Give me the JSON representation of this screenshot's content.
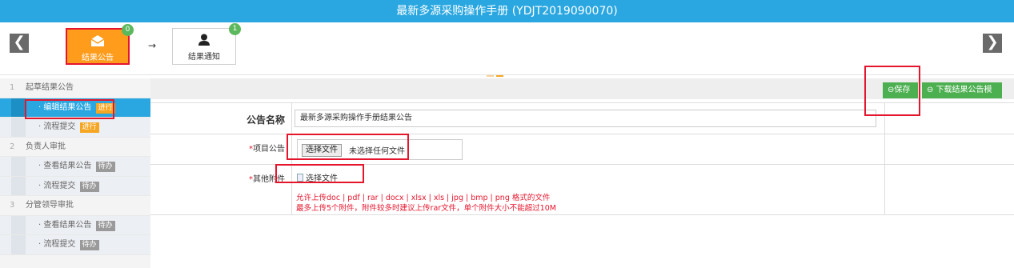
{
  "title": "最新多源采购操作手册 (YDJT2019090070)",
  "nav": {
    "prev": "❮",
    "next": "❯"
  },
  "steps": [
    {
      "label": "结果公告",
      "badge": "0"
    },
    {
      "label": "结果通知",
      "badge": "1"
    }
  ],
  "step_arrow": "→",
  "sidebar": {
    "items": [
      {
        "num": "1",
        "label": "起草结果公告"
      },
      {
        "label": "· 编辑结果公告",
        "tag": "进行"
      },
      {
        "label": "· 流程提交",
        "tag": "进行"
      },
      {
        "num": "2",
        "label": "负责人审批"
      },
      {
        "label": "· 查看结果公告",
        "tag": "待办"
      },
      {
        "label": "· 流程提交",
        "tag": "待办"
      },
      {
        "num": "3",
        "label": "分管领导审批"
      },
      {
        "label": "· 查看结果公告",
        "tag": "待办"
      },
      {
        "label": "· 流程提交",
        "tag": "待办"
      }
    ]
  },
  "toolbar": {
    "save_label": "⊖保存",
    "download_label": "⊖ 下载结果公告模板"
  },
  "form": {
    "name_label": "公告名称",
    "name_value": "最新多源采购操作手册结果公告",
    "project_label": "项目公告",
    "file_button": "选择文件",
    "file_status": "未选择任何文件",
    "attachment_label": "其他附件",
    "attach_button": "选择文件",
    "hint1": "允许上传doc | pdf | rar | docx | xlsx | xls | jpg | bmp | png 格式的文件",
    "hint2": "最多上传5个附件，附件较多时建议上传rar文件，单个附件大小不能超过10M",
    "required_mark": "*"
  },
  "colors": {
    "header": "#2aa7e0",
    "active_step": "#ff9c1c",
    "button": "#4caf50",
    "highlight": "#e4162d"
  }
}
